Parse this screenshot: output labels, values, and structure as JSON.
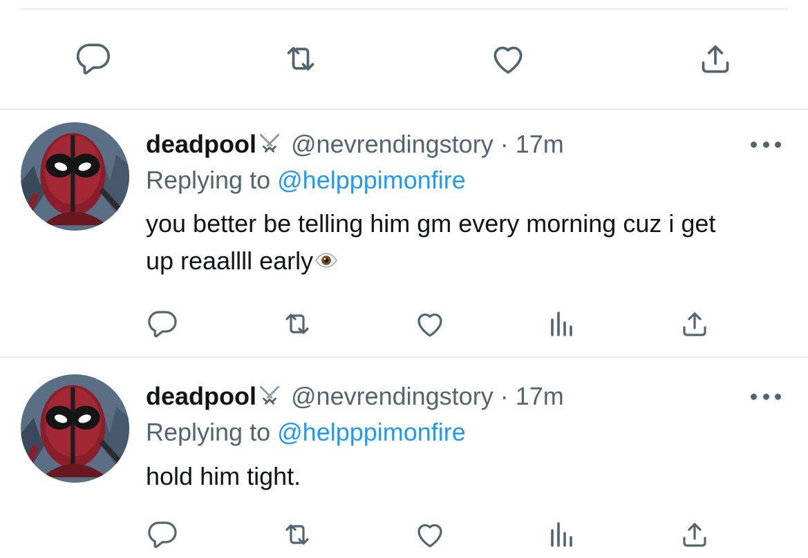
{
  "colors": {
    "text": "#0f1419",
    "secondary": "#536471",
    "link": "#1d9bf0",
    "divider": "#e6e9ec"
  },
  "top_actions": [
    {
      "icon": "reply-icon"
    },
    {
      "icon": "retweet-icon"
    },
    {
      "icon": "like-icon"
    },
    {
      "icon": "share-icon"
    }
  ],
  "tweets": [
    {
      "display_name": "deadpool",
      "name_emoji": "crossed-swords-icon",
      "handle": "@nevrendingstory",
      "separator": "·",
      "time": "17m",
      "reply_prefix": "Replying to",
      "reply_mention": "@helpppimonfire",
      "text_line_1": "you better be telling him gm every morning cuz i get",
      "text_line_2": "up reaallll early",
      "text_emoji": "eye-icon",
      "actions": [
        "reply-icon",
        "retweet-icon",
        "like-icon",
        "analytics-icon",
        "share-icon"
      ]
    },
    {
      "display_name": "deadpool",
      "name_emoji": "crossed-swords-icon",
      "handle": "@nevrendingstory",
      "separator": "·",
      "time": "17m",
      "reply_prefix": "Replying to",
      "reply_mention": "@helpppimonfire",
      "text_line_1": "hold him tight.",
      "actions": [
        "reply-icon",
        "retweet-icon",
        "like-icon",
        "analytics-icon",
        "share-icon"
      ]
    }
  ]
}
